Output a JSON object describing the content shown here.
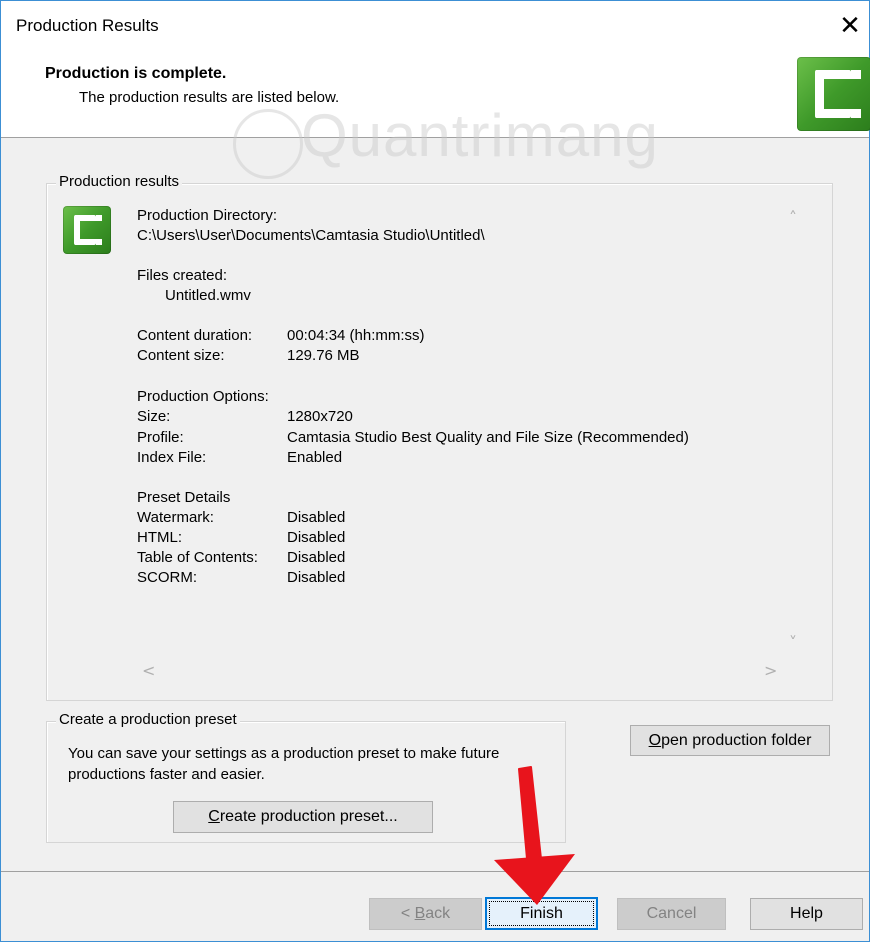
{
  "window": {
    "title": "Production Results",
    "close_glyph": "✕"
  },
  "header": {
    "heading": "Production is complete.",
    "subheading": "The production results are listed below."
  },
  "watermark": "Quantrimang",
  "results": {
    "legend": "Production results",
    "production_directory_label": "Production Directory:",
    "production_directory_value": "C:\\Users\\User\\Documents\\Camtasia Studio\\Untitled\\",
    "files_created_label": "Files created:",
    "files_created_value": "Untitled.wmv",
    "content_duration_label": "Content duration:",
    "content_duration_value": "00:04:34 (hh:mm:ss)",
    "content_size_label": "Content size:",
    "content_size_value": "129.76 MB",
    "production_options_label": "Production Options:",
    "size_label": "Size:",
    "size_value": "1280x720",
    "profile_label": "Profile:",
    "profile_value": "Camtasia Studio Best Quality and File Size (Recommended)",
    "index_file_label": "Index File:",
    "index_file_value": "Enabled",
    "preset_details_label": "Preset Details",
    "watermark_label": "Watermark:",
    "watermark_value": "Disabled",
    "html_label": "HTML:",
    "html_value": "Disabled",
    "toc_label": "Table of Contents:",
    "toc_value": "Disabled",
    "scorm_label": "SCORM:",
    "scorm_value": "Disabled",
    "scroll_up": "˄",
    "scroll_down": "˅",
    "scroll_left": "<",
    "scroll_right": ">"
  },
  "preset": {
    "legend": "Create a production preset",
    "description": "You can save your settings as a production preset to make future productions faster and easier.",
    "create_button_key": "C",
    "create_button_rest": "reate production preset..."
  },
  "open_folder": {
    "key": "O",
    "rest": "pen production folder"
  },
  "footer": {
    "back_prefix": "< ",
    "back_key": "B",
    "back_rest": "ack",
    "finish": "Finish",
    "cancel": "Cancel",
    "help": "Help"
  },
  "colors": {
    "accent_focus": "#0078d7",
    "arrow_red": "#e8141c",
    "logo_green": "#3f9a2a"
  },
  "icons": [
    "camtasia-logo-icon",
    "close-icon",
    "scroll-up-icon",
    "scroll-down-icon",
    "scroll-left-icon",
    "scroll-right-icon",
    "red-arrow-annotation"
  ]
}
